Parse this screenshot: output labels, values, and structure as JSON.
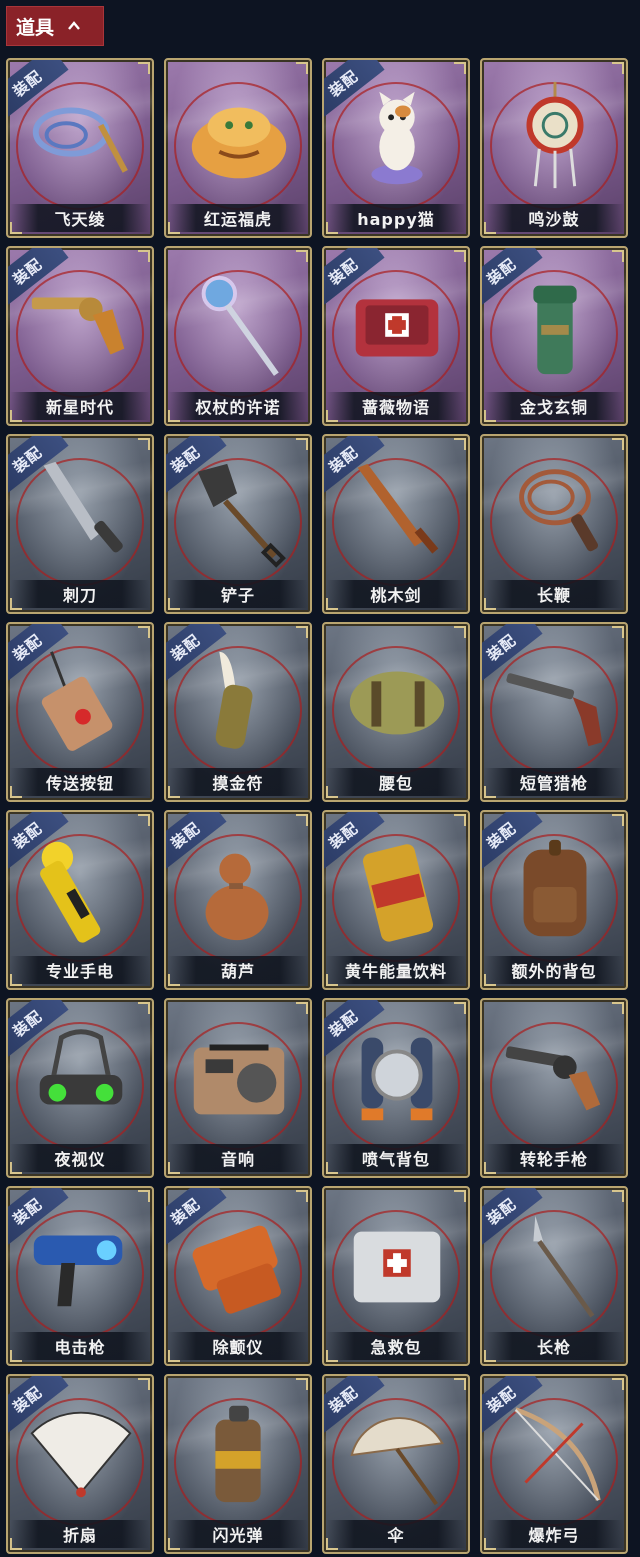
{
  "header": {
    "title": "道具"
  },
  "equip_badge": "装配",
  "items": [
    {
      "name": "飞天绫",
      "equipped": true,
      "rarity": "purple",
      "icon": "ribbon-icon"
    },
    {
      "name": "红运福虎",
      "equipped": false,
      "rarity": "purple",
      "icon": "tiger-icon"
    },
    {
      "name": "happy猫",
      "equipped": true,
      "rarity": "purple",
      "icon": "cat-icon"
    },
    {
      "name": "鸣沙鼓",
      "equipped": false,
      "rarity": "purple",
      "icon": "drum-icon"
    },
    {
      "name": "新星时代",
      "equipped": true,
      "rarity": "purple",
      "icon": "revolver-icon"
    },
    {
      "name": "权杖的许诺",
      "equipped": false,
      "rarity": "purple",
      "icon": "scepter-icon"
    },
    {
      "name": "蔷薇物语",
      "equipped": true,
      "rarity": "purple",
      "icon": "medkit-icon"
    },
    {
      "name": "金戈玄铜",
      "equipped": true,
      "rarity": "purple",
      "icon": "bronze-cannon-icon"
    },
    {
      "name": "刺刀",
      "equipped": true,
      "rarity": "gray",
      "icon": "bayonet-icon"
    },
    {
      "name": "铲子",
      "equipped": true,
      "rarity": "gray",
      "icon": "shovel-icon"
    },
    {
      "name": "桃木剑",
      "equipped": true,
      "rarity": "gray",
      "icon": "wooden-sword-icon"
    },
    {
      "name": "长鞭",
      "equipped": false,
      "rarity": "gray",
      "icon": "whip-icon"
    },
    {
      "name": "传送按钮",
      "equipped": true,
      "rarity": "gray",
      "icon": "teleport-button-icon"
    },
    {
      "name": "摸金符",
      "equipped": true,
      "rarity": "gray",
      "icon": "talisman-icon"
    },
    {
      "name": "腰包",
      "equipped": false,
      "rarity": "gray",
      "icon": "waist-bag-icon"
    },
    {
      "name": "短管猎枪",
      "equipped": true,
      "rarity": "gray",
      "icon": "shotgun-icon"
    },
    {
      "name": "专业手电",
      "equipped": true,
      "rarity": "gray",
      "icon": "flashlight-icon"
    },
    {
      "name": "葫芦",
      "equipped": true,
      "rarity": "gray",
      "icon": "gourd-icon"
    },
    {
      "name": "黄牛能量饮料",
      "equipped": true,
      "rarity": "gray",
      "icon": "energy-drink-icon"
    },
    {
      "name": "额外的背包",
      "equipped": true,
      "rarity": "gray",
      "icon": "backpack-icon"
    },
    {
      "name": "夜视仪",
      "equipped": true,
      "rarity": "gray",
      "icon": "night-vision-icon"
    },
    {
      "name": "音响",
      "equipped": false,
      "rarity": "gray",
      "icon": "radio-icon"
    },
    {
      "name": "喷气背包",
      "equipped": true,
      "rarity": "gray",
      "icon": "jetpack-icon"
    },
    {
      "name": "转轮手枪",
      "equipped": false,
      "rarity": "gray",
      "icon": "pistol-icon"
    },
    {
      "name": "电击枪",
      "equipped": true,
      "rarity": "gray",
      "icon": "stun-gun-icon"
    },
    {
      "name": "除颤仪",
      "equipped": true,
      "rarity": "gray",
      "icon": "defibrillator-icon"
    },
    {
      "name": "急救包",
      "equipped": false,
      "rarity": "gray",
      "icon": "first-aid-kit-icon"
    },
    {
      "name": "长枪",
      "equipped": true,
      "rarity": "gray",
      "icon": "spear-icon"
    },
    {
      "name": "折扇",
      "equipped": true,
      "rarity": "gray",
      "icon": "folding-fan-icon"
    },
    {
      "name": "闪光弹",
      "equipped": false,
      "rarity": "gray",
      "icon": "flashbang-icon"
    },
    {
      "name": "伞",
      "equipped": true,
      "rarity": "gray",
      "icon": "umbrella-icon"
    },
    {
      "name": "爆炸弓",
      "equipped": true,
      "rarity": "gray",
      "icon": "bow-icon"
    }
  ]
}
